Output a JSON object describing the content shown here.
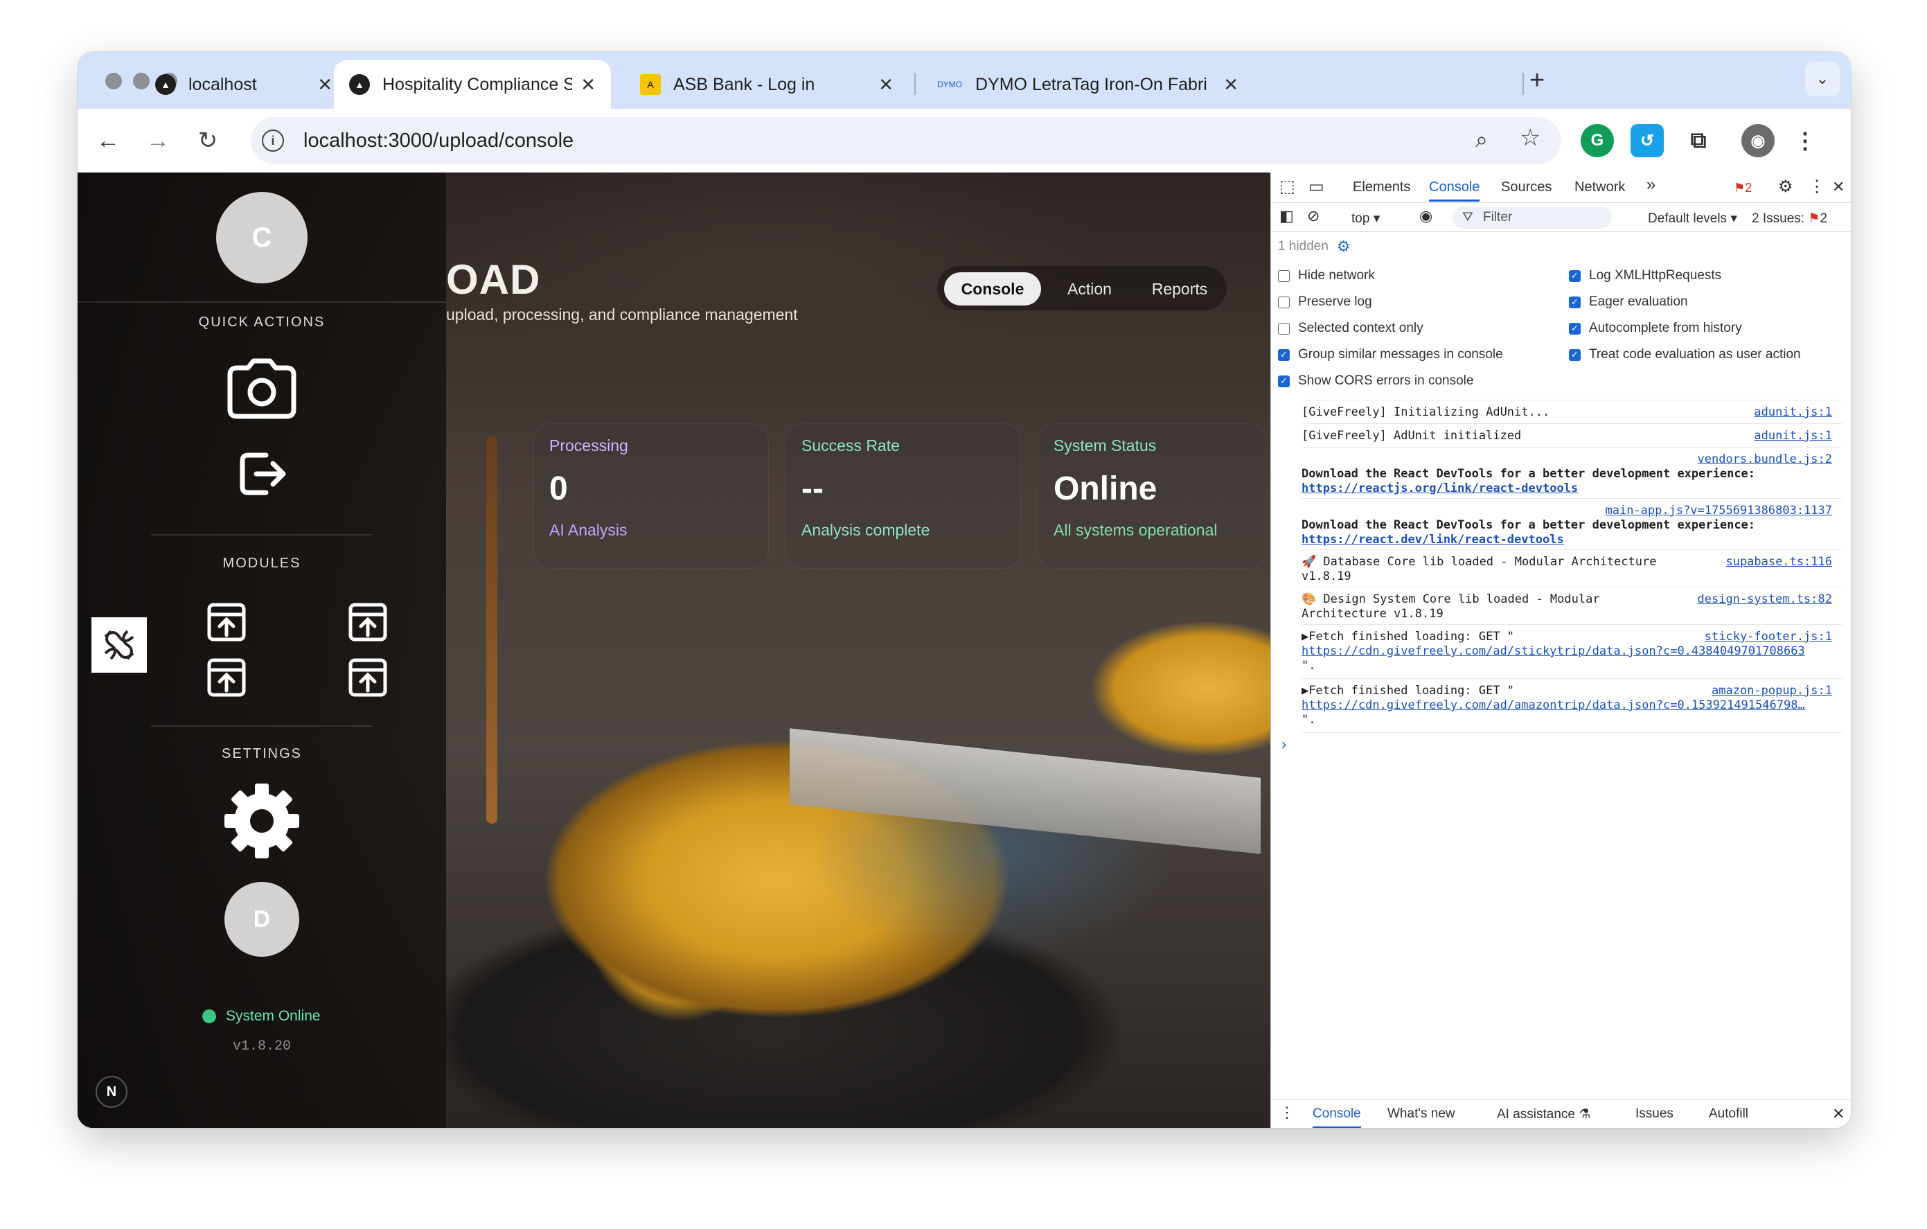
{
  "browser": {
    "tabs": [
      {
        "title": "localhost",
        "active": false
      },
      {
        "title": "Hospitality Compliance SaaS",
        "active": true
      },
      {
        "title": "ASB Bank - Log in",
        "active": false
      },
      {
        "title": "DYMO LetraTag Iron-On Fabri",
        "active": false
      }
    ],
    "url": "localhost:3000/upload/console"
  },
  "sidebar": {
    "top_avatar": "C",
    "quick_actions_label": "QUICK ACTIONS",
    "modules_label": "MODULES",
    "settings_label": "SETTINGS",
    "bottom_avatar": "D",
    "status_text": "System Online",
    "version": "v1.8.20",
    "nextjs_badge": "N"
  },
  "main": {
    "heading_fragment": "OAD",
    "subtitle_fragment": "upload, processing, and compliance management",
    "segments": [
      "Console",
      "Action",
      "Reports"
    ],
    "active_segment": "Console",
    "cards": [
      {
        "label": "Processing",
        "value": "0",
        "sub": "AI Analysis",
        "label_color": "#c7b6ff",
        "sub_color": "#b9a8ff"
      },
      {
        "label": "Success Rate",
        "value": "--",
        "sub": "Analysis complete",
        "label_color": "#8fe3c0",
        "sub_color": "#8fe3c0"
      },
      {
        "label": "System Status",
        "value": "Online",
        "sub": "All systems operational",
        "label_color": "#8fe3c0",
        "sub_color": "#7fdcb0"
      }
    ]
  },
  "devtools": {
    "tabs": [
      "Elements",
      "Console",
      "Sources",
      "Network"
    ],
    "active_tab": "Console",
    "error_count": "2",
    "context": "top",
    "filter_placeholder": "Filter",
    "levels": "Default levels",
    "issues": "2 Issues:",
    "issues_count": "2",
    "hidden": "1 hidden",
    "options_left": [
      {
        "label": "Hide network",
        "checked": false
      },
      {
        "label": "Preserve log",
        "checked": false
      },
      {
        "label": "Selected context only",
        "checked": false
      },
      {
        "label": "Group similar messages in console",
        "checked": true
      },
      {
        "label": "Show CORS errors in console",
        "checked": true
      }
    ],
    "options_right": [
      {
        "label": "Log XMLHttpRequests",
        "checked": true
      },
      {
        "label": "Eager evaluation",
        "checked": true
      },
      {
        "label": "Autocomplete from history",
        "checked": true
      },
      {
        "label": "Treat code evaluation as user action",
        "checked": true
      }
    ],
    "messages": [
      {
        "text": "[GiveFreely] Initializing AdUnit...",
        "source": "adunit.js:1"
      },
      {
        "text": "[GiveFreely] AdUnit initialized",
        "source": "adunit.js:1"
      },
      {
        "source": "vendors.bundle.js:2",
        "text": "Download the React DevTools for a better development experience:",
        "link": "https://reactjs.org/link/react-devtools"
      },
      {
        "source": "main-app.js?v=1755691386803:1137",
        "text": "Download the React DevTools for a better development experience:",
        "link": "https://react.dev/link/react-devtools"
      },
      {
        "text": "🚀 Database Core lib loaded - Modular Architecture",
        "text2": "v1.8.19",
        "source": "supabase.ts:116"
      },
      {
        "text": "🎨 Design System Core lib loaded - Modular",
        "text2": "Architecture v1.8.19",
        "source": "design-system.ts:82"
      },
      {
        "text": "▶Fetch finished loading: GET \"",
        "link": "https://cdn.givefreely.com/ad/stickytrip/data.json?c=0.4384049701708663",
        "text3": "\".",
        "source": "sticky-footer.js:1"
      },
      {
        "text": "▶Fetch finished loading: GET \"",
        "link": "https://cdn.givefreely.com/ad/amazontrip/data.json?c=0.153921491546798…",
        "text3": "\".",
        "source": "amazon-popup.js:1"
      }
    ],
    "prompt": "›",
    "drawer_tabs": [
      "Console",
      "What's new",
      "AI assistance",
      "Issues",
      "Autofill"
    ]
  }
}
